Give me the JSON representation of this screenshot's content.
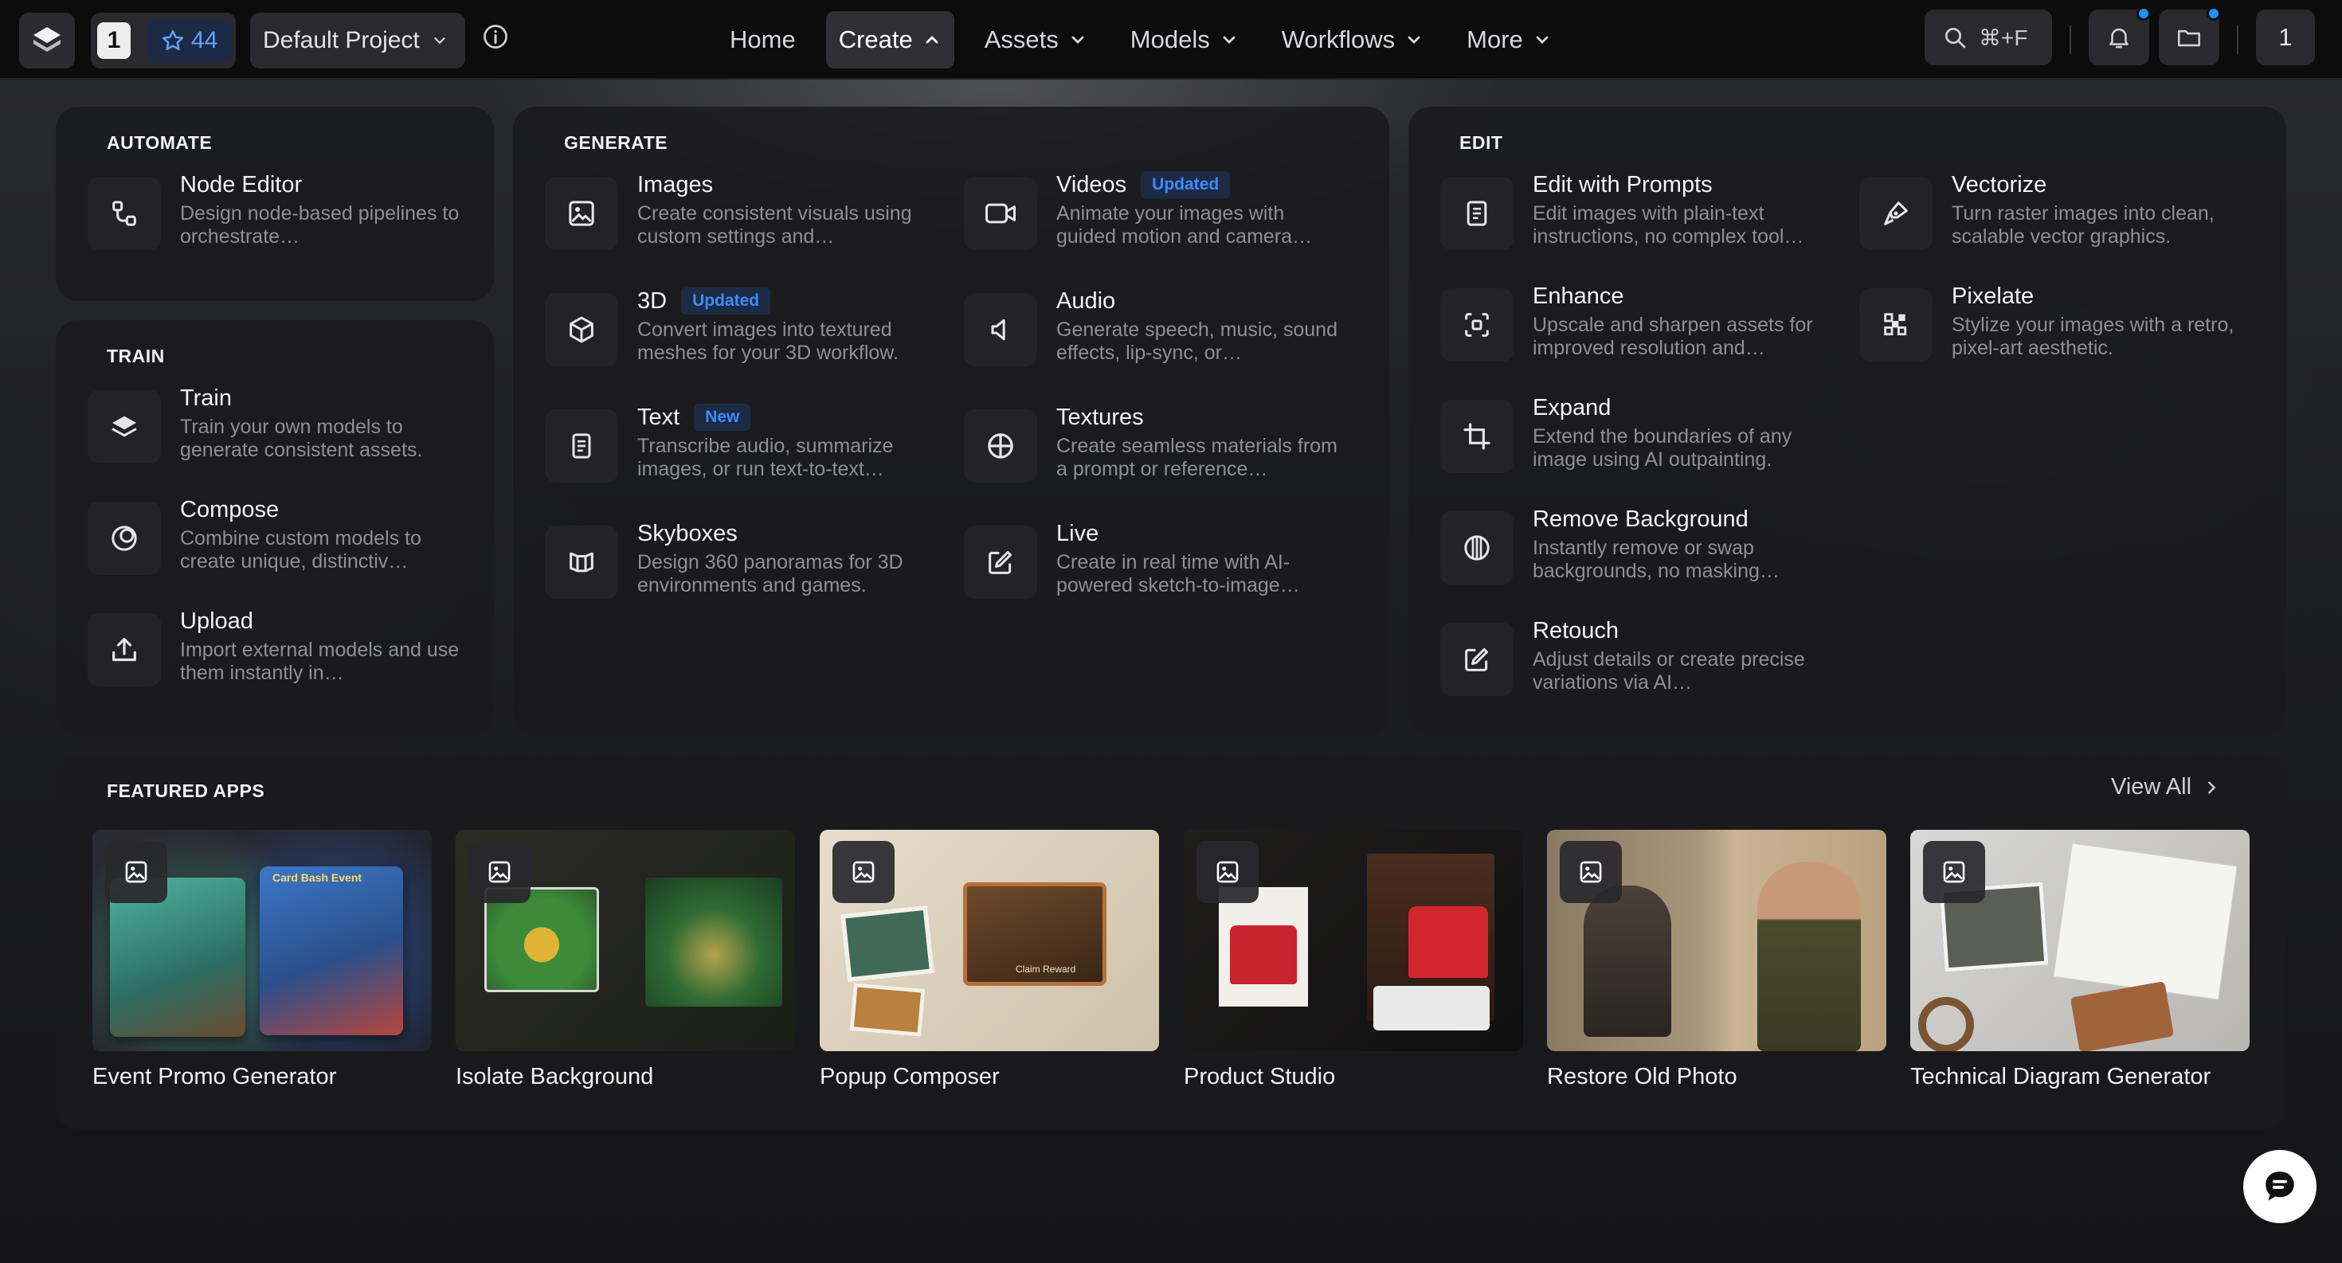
{
  "topbar": {
    "workspace_number": "1",
    "credits": "44",
    "project": "Default Project",
    "nav": [
      "Home",
      "Create",
      "Assets",
      "Models",
      "Workflows",
      "More"
    ],
    "search_shortcut": "⌘+F",
    "user_initial": "1"
  },
  "automate": {
    "title": "AUTOMATE",
    "items": [
      {
        "title": "Node Editor",
        "desc": "Design node-based pipelines to orchestrate…",
        "icon": "node-editor-icon"
      }
    ]
  },
  "train": {
    "title": "TRAIN",
    "items": [
      {
        "title": "Train",
        "desc": "Train your own models to generate consistent assets.",
        "icon": "layers-icon"
      },
      {
        "title": "Compose",
        "desc": "Combine custom models to create unique, distinctiv…",
        "icon": "compose-icon"
      },
      {
        "title": "Upload",
        "desc": "Import external models and use them instantly in…",
        "icon": "upload-icon"
      }
    ]
  },
  "generate": {
    "title": "GENERATE",
    "items": [
      {
        "title": "Images",
        "tag": "",
        "desc": "Create consistent visuals using custom settings and…",
        "icon": "image-icon"
      },
      {
        "title": "Videos",
        "tag": "Updated",
        "desc": "Animate your images with guided motion and camera…",
        "icon": "video-icon"
      },
      {
        "title": "3D",
        "tag": "Updated",
        "desc": "Convert images into textured meshes for your 3D workflow.",
        "icon": "cube-icon"
      },
      {
        "title": "Audio",
        "tag": "",
        "desc": "Generate speech, music, sound effects, lip-sync, or…",
        "icon": "speaker-icon"
      },
      {
        "title": "Text",
        "tag": "New",
        "desc": "Transcribe audio, summarize images, or run text-to-text…",
        "icon": "document-icon"
      },
      {
        "title": "Textures",
        "tag": "",
        "desc": "Create seamless materials from a prompt or reference…",
        "icon": "texture-icon"
      },
      {
        "title": "Skyboxes",
        "tag": "",
        "desc": "Design 360 panoramas for 3D environments and games.",
        "icon": "skybox-icon"
      },
      {
        "title": "Live",
        "tag": "",
        "desc": "Create in real time with AI-powered sketch-to-image…",
        "icon": "live-edit-icon"
      }
    ]
  },
  "edit": {
    "title": "EDIT",
    "items": [
      {
        "title": "Edit with Prompts",
        "desc": "Edit images with plain-text instructions, no complex tool…",
        "icon": "prompt-edit-icon"
      },
      {
        "title": "Vectorize",
        "desc": "Turn raster images into clean, scalable vector graphics.",
        "icon": "pen-tool-icon"
      },
      {
        "title": "Enhance",
        "desc": "Upscale and sharpen assets for improved resolution and…",
        "icon": "enhance-icon"
      },
      {
        "title": "Pixelate",
        "desc": "Stylize your images with a retro, pixel-art aesthetic.",
        "icon": "pixelate-icon"
      },
      {
        "title": "Expand",
        "desc": "Extend the boundaries of any image using AI outpainting.",
        "icon": "crop-expand-icon"
      },
      {
        "title": "Remove Background",
        "desc": "Instantly remove or swap backgrounds, no masking…",
        "icon": "remove-bg-icon"
      },
      {
        "title": "Retouch",
        "desc": "Adjust details or create precise variations via AI…",
        "icon": "retouch-icon"
      }
    ]
  },
  "featured": {
    "title": "FEATURED APPS",
    "view_all": "View All",
    "apps": [
      {
        "label": "Event Promo Generator",
        "thumb_text": "Card Bash Event"
      },
      {
        "label": "Isolate Background",
        "thumb_text": ""
      },
      {
        "label": "Popup Composer",
        "thumb_text": "Claim Reward"
      },
      {
        "label": "Product Studio",
        "thumb_text": ""
      },
      {
        "label": "Restore Old Photo",
        "thumb_text": ""
      },
      {
        "label": "Technical Diagram Generator",
        "thumb_text": ""
      }
    ]
  }
}
